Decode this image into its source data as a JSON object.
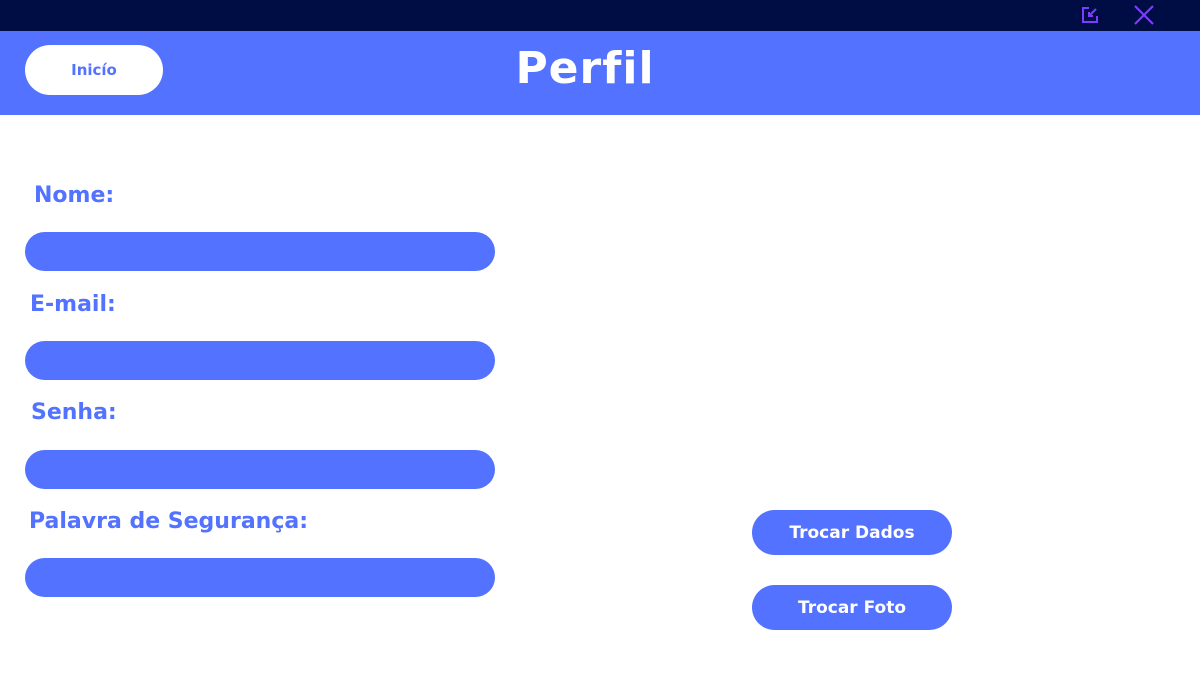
{
  "window": {
    "controls": [
      {
        "name": "minimize",
        "icon": "edit-square-icon"
      },
      {
        "name": "close",
        "icon": "close-icon"
      }
    ]
  },
  "header": {
    "home_label": "Inicío",
    "title": "Perfil"
  },
  "form": {
    "fields": [
      {
        "label": "Nome:",
        "value": ""
      },
      {
        "label": "E-mail:",
        "value": ""
      },
      {
        "label": "Senha:",
        "value": ""
      },
      {
        "label": "Palavra de Segurança:",
        "value": ""
      }
    ]
  },
  "actions": {
    "change_data_label": "Trocar Dados",
    "change_photo_label": "Trocar Foto"
  },
  "colors": {
    "primary": "#5272ff",
    "titlebar": "#000d45",
    "window_icons": "#7b3cff",
    "background": "#ffffff"
  }
}
